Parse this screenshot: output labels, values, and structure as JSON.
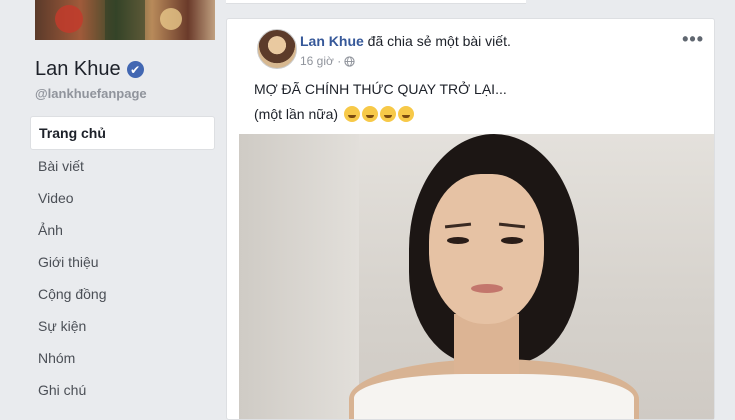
{
  "page": {
    "name": "Lan Khue",
    "handle": "@lankhuefanpage",
    "verified_mark": "✔"
  },
  "nav": {
    "items": [
      {
        "label": "Trang chủ",
        "active": true
      },
      {
        "label": "Bài viết"
      },
      {
        "label": "Video"
      },
      {
        "label": "Ảnh"
      },
      {
        "label": "Giới thiệu"
      },
      {
        "label": "Cộng đồng"
      },
      {
        "label": "Sự kiện"
      },
      {
        "label": "Nhóm"
      },
      {
        "label": "Ghi chú"
      }
    ]
  },
  "post": {
    "author": "Lan Khue",
    "action": "đã chia sẻ một bài viết.",
    "time": "16 giờ ·",
    "privacy_icon": "globe-icon",
    "more_label": "•••",
    "text_line1": "MỢ ĐÃ CHÍNH THỨC QUAY TRỞ LẠI...",
    "text_line2": "(một lần nữa)",
    "emojis": [
      "laughing-emoji",
      "rofl-emoji",
      "laughing-emoji",
      "rofl-emoji"
    ]
  },
  "colors": {
    "background": "#e9ebee",
    "link": "#365899",
    "verified": "#4267b2"
  }
}
